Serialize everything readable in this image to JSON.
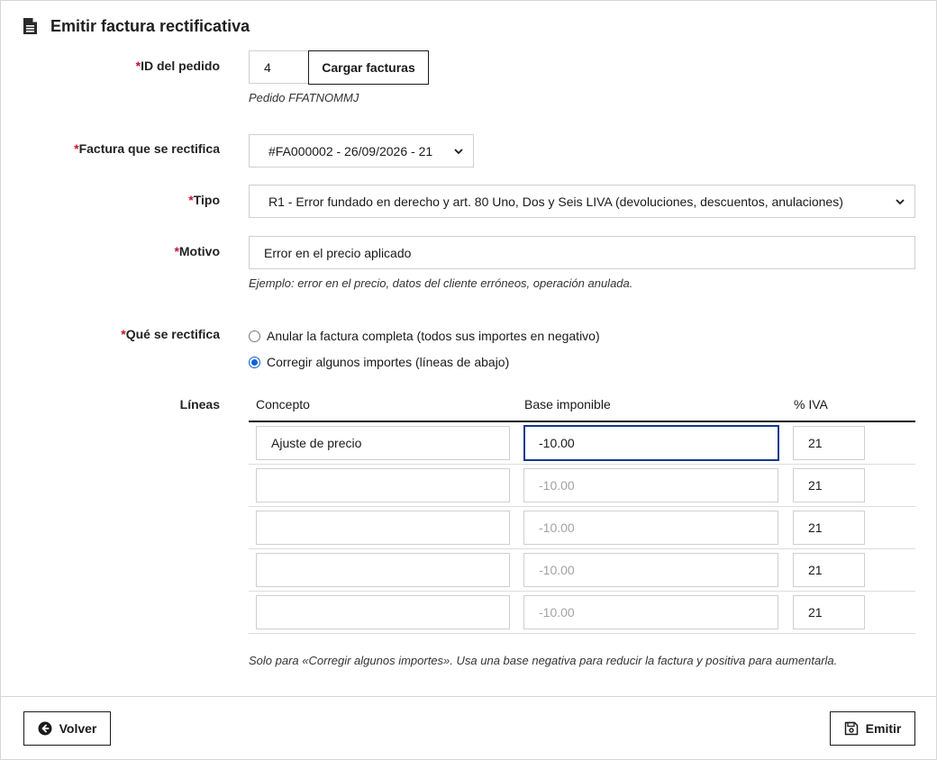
{
  "header": {
    "title": "Emitir factura rectificativa",
    "icon": "document-icon"
  },
  "form": {
    "order_id": {
      "label": "ID del pedido",
      "value": "4",
      "load_button": "Cargar facturas",
      "hint": "Pedido FFATNOMMJ"
    },
    "invoice": {
      "label": "Factura que se rectifica",
      "selected": "#FA000002 - 26/09/2026 - 21"
    },
    "type": {
      "label": "Tipo",
      "selected": "R1 - Error fundado en derecho y art. 80 Uno, Dos y Seis LIVA (devoluciones, descuentos, anulaciones)"
    },
    "reason": {
      "label": "Motivo",
      "value": "Error en el precio aplicado",
      "hint": "Ejemplo: error en el precio, datos del cliente erróneos, operación anulada."
    },
    "scope": {
      "label": "Qué se rectifica",
      "options": [
        {
          "label": "Anular la factura completa (todos sus importes en negativo)",
          "checked": false
        },
        {
          "label": "Corregir algunos importes (líneas de abajo)",
          "checked": true
        }
      ]
    },
    "lines": {
      "label": "Líneas",
      "columns": [
        "Concepto",
        "Base imponible",
        "% IVA"
      ],
      "base_placeholder": "-10.00",
      "rows": [
        {
          "concept": "Ajuste de precio",
          "base": "-10.00",
          "iva": "21"
        },
        {
          "concept": "",
          "base": "",
          "iva": "21"
        },
        {
          "concept": "",
          "base": "",
          "iva": "21"
        },
        {
          "concept": "",
          "base": "",
          "iva": "21"
        },
        {
          "concept": "",
          "base": "",
          "iva": "21"
        }
      ],
      "hint": "Solo para «Corregir algunos importes». Usa una base negativa para reducir la factura y positiva para aumentarla."
    },
    "required_marker": "*"
  },
  "footer": {
    "back_button": "Volver",
    "submit_button": "Emitir"
  },
  "colors": {
    "required": "#c8102e",
    "radio_accent": "#0a62d6",
    "focus_border": "#0d3a8c"
  }
}
